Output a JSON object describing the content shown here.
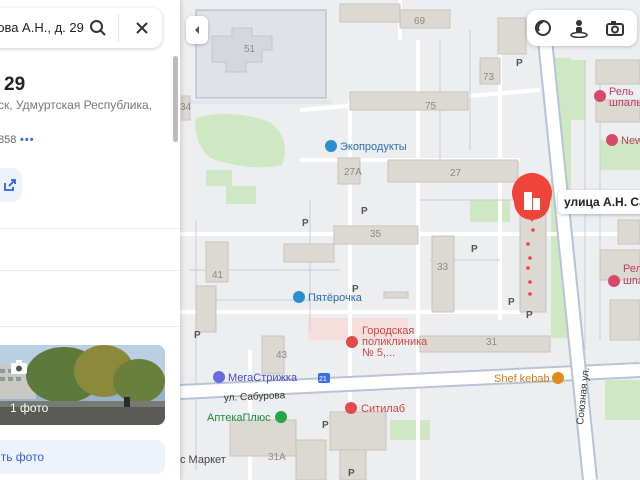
{
  "search": {
    "value": "рова А.Н., д. 29"
  },
  "place": {
    "title": "29",
    "subtitle": "ск, Удмуртская Республика,",
    "code": "858",
    "more": "•••"
  },
  "photos": {
    "count_label": "1 фото",
    "add_label": "ить фото"
  },
  "map": {
    "labels": {
      "bld69": "69",
      "bld51": "51",
      "bld73": "73",
      "bld75": "75",
      "bld34": "34",
      "bld27a": "27А",
      "bld27": "27",
      "bld35": "35",
      "bld41": "41",
      "bld33": "33",
      "bld43": "43",
      "bld31": "31",
      "bld31a": "31А",
      "street_saburova": "ул. Сабурова",
      "street_soyuznaya": "Союзная ул.",
      "marker": "улица А.Н. Са"
    },
    "pois": [
      {
        "name": "Экопродукты"
      },
      {
        "name": "Пятёрочка"
      },
      {
        "name": "Городская"
      },
      {
        "name": "поликлиника"
      },
      {
        "name": "№ 5,..."
      },
      {
        "name": "МегаСтрижка"
      },
      {
        "name": "Shef kebab"
      },
      {
        "name": "АптекаПлюс"
      },
      {
        "name": "Ситилаб"
      },
      {
        "name": "с Маркет"
      },
      {
        "name": "Рель"
      },
      {
        "name": "шпаль"
      },
      {
        "name": "New"
      },
      {
        "name": "Рель"
      },
      {
        "name": "шпа"
      }
    ],
    "parking": "P",
    "bus": "21"
  },
  "colors": {
    "accent_red": "#f0443a",
    "accent_blue": "#2b62d6",
    "poi_blue": "#2a8fd0",
    "poi_red": "#e44a4a",
    "poi_orange": "#e48a1a",
    "poi_green": "#27a348",
    "poi_pink": "#d84a6a"
  },
  "icons": {
    "search": "search-icon",
    "close": "close-icon",
    "collapse": "chevron-left-icon",
    "layers": "layers-icon",
    "panorama": "street-view-icon",
    "camera": "camera-icon",
    "marker": "building-pin-icon"
  }
}
